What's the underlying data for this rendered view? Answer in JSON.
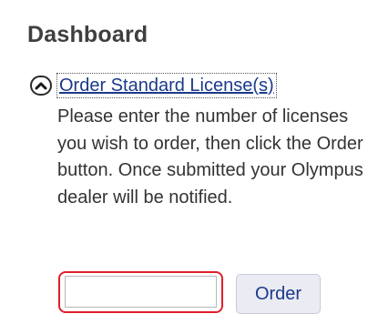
{
  "panel": {
    "title": "Dashboard",
    "section": {
      "toggle_icon": "chevron-up-icon",
      "link_label": "Order Standard License(s)",
      "description": "Please enter the number of licenses you wish to order, then click the Order button. Once submitted your Olympus dealer will be notified."
    },
    "order_form": {
      "quantity_value": "",
      "quantity_placeholder": "",
      "order_label": "Order"
    }
  },
  "colors": {
    "title": "#3f3f3f",
    "link": "#1a3a8a",
    "input_focus_border": "#e0202a",
    "button_background": "#ebebf3"
  }
}
